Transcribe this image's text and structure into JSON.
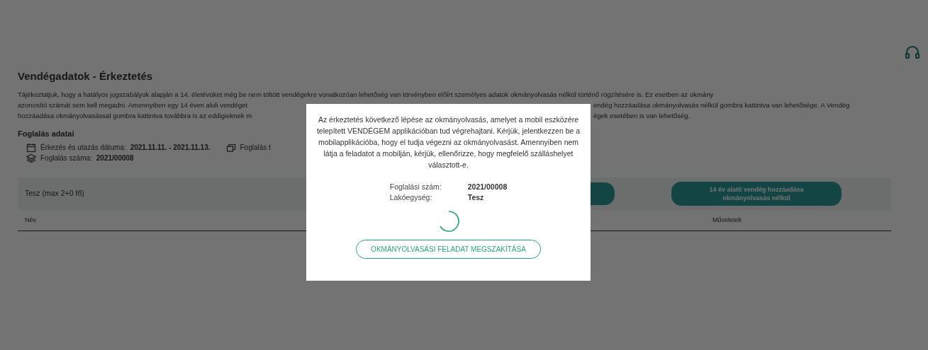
{
  "page": {
    "title": "Vendégadatok - Érkeztetés",
    "notice_lines": [
      {
        "left": "Tájékoztatjuk, hogy a hatályos jogszabályok alapján a 14. életévüket még be nem töltött vendégekre vonatkozóan lehetőség van törvényben előírt személyes adatok okmányolvasás nélkül történő rögzítésére is. Ez esetben az okmány"
      },
      {
        "left": "azonosító számát sem kell megadni. Amennyiben egy 14 éven aluli vendéget",
        "right": "endég hozzáadása okmányolvasás nélkül gombra kattintva van lehetősége. A Vendég"
      },
      {
        "left": "hozzáadása okmányolvasással gombra kattintva továbbra is az eddigieknek m",
        "right": "égek esetében is van lehetőség."
      }
    ],
    "booking_heading": "Foglalás adatai",
    "booking_rows": [
      {
        "kind": "calendar",
        "label": "Érkezés és utazás dátuma:",
        "value": "2021.11.11. - 2021.11.13.",
        "extra_label": "Foglalás t"
      },
      {
        "kind": "layers",
        "label": "Foglalás száma:",
        "value": "2021/00008",
        "extra_label": ""
      }
    ],
    "unit_title": "Tesz (max 2+0 fő)",
    "add_minor_button": "14 év alatti vendég hozzáadása okmányolvasás nélkül",
    "columns": [
      "Név",
      "Műveletek"
    ]
  },
  "modal": {
    "message": "Az érkeztetés következő lépése az okmányolvasás, amelyet a mobil eszközére telepített VENDÉGEM applikációban tud végrehajtani. Kérjük, jelentkezzen be a mobilapplikációba, hogy el tudja végezni az okmányolvasást. Amennyiben nem látja a feladatot a mobilján, kérjük, ellenőrizze, hogy megfelelő szálláshelyet választott-e.",
    "fields": [
      {
        "label": "Foglalási szám:",
        "value": "2021/00008"
      },
      {
        "label": "Lakóegység:",
        "value": "Tesz"
      }
    ],
    "cancel_button": "OKMÁNYOLVASÁSI FELADAT MEGSZAKÍTÁSA"
  }
}
